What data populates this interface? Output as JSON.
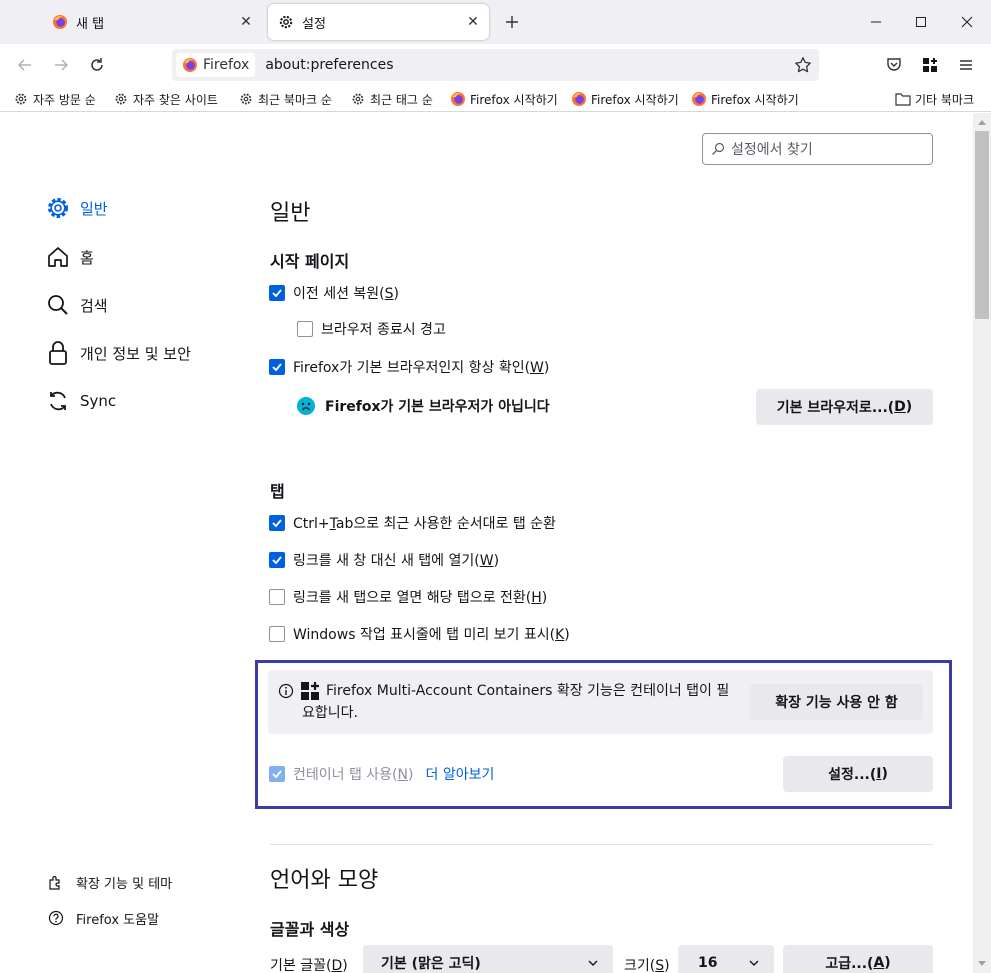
{
  "tabs": [
    {
      "label": "새 탭",
      "icon": "firefox-icon"
    },
    {
      "label": "설정",
      "icon": "gear-icon"
    }
  ],
  "nav": {
    "identity_label": "Firefox",
    "url": "about:preferences"
  },
  "bookmarks": [
    "자주 방문 순",
    "자주 찾은 사이트",
    "최근 북마크 순",
    "최근 태그 순",
    "Firefox 시작하기",
    "Firefox 시작하기",
    "Firefox 시작하기"
  ],
  "bookmarks_other": "기타 북마크",
  "search_placeholder": "설정에서 찾기",
  "categories": [
    "일반",
    "홈",
    "검색",
    "개인 정보 및 보안",
    "Sync"
  ],
  "footer": {
    "extensions": "확장 기능 및 테마",
    "help": "Firefox 도움말"
  },
  "general": {
    "title": "일반",
    "startup": {
      "title": "시작 페이지",
      "restore_session": {
        "text": "이전 세션 복원(",
        "key": "S",
        "end": ")",
        "checked": true
      },
      "warn_on_quit": {
        "text": "브라우저 종료시 경고",
        "checked": false
      },
      "check_default": {
        "text": "Firefox가 기본 브라우저인지 항상 확인(",
        "key": "W",
        "end": ")",
        "checked": true
      },
      "not_default": "Firefox가 기본 브라우저가 아닙니다",
      "make_default": {
        "text": "기본 브라우저로...(",
        "key": "D",
        "end": ")"
      }
    },
    "tabs": {
      "title": "탭",
      "ctrl_tab": {
        "pre": "Ctrl+",
        "key": "T",
        "post": "ab으로 최근 사용한 순서대로 탭 순환",
        "checked": true
      },
      "open_links": {
        "text": "링크를 새 창 대신 새 탭에 열기(",
        "key": "W",
        "end": ")",
        "checked": true
      },
      "switch_to_tab": {
        "text": "링크를 새 탭으로 열면 해당 탭으로 전환(",
        "key": "H",
        "end": ")",
        "checked": false
      },
      "taskbar_preview": {
        "text": "Windows 작업 표시줄에 탭 미리 보기 표시(",
        "key": "K",
        "end": ")",
        "checked": false
      },
      "containers_notice": "Firefox Multi-Account Containers 확장 기능은 컨테이너 탭이 필요합니다.",
      "disable_extension": "확장 기능 사용 안 함",
      "container_tabs": {
        "text": "컨테이너 탭 사용(",
        "key": "N",
        "end": ")",
        "checked": true,
        "disabled": true
      },
      "learn_more": "더 알아보기",
      "settings": {
        "text": "설정...(",
        "key": "I",
        "end": ")"
      }
    }
  },
  "language": {
    "title": "언어와 모양",
    "fonts": {
      "title": "글꼴과 색상",
      "default_font": {
        "text": "기본 글꼴(",
        "key": "D",
        "end": ")"
      },
      "font_value": "기본 (맑은 고딕)",
      "size": {
        "text": "크기(",
        "key": "S",
        "end": ")"
      },
      "size_value": "16",
      "advanced": {
        "text": "고급...(",
        "key": "A",
        "end": ")"
      }
    }
  },
  "colors": {
    "accent": "#0061e0",
    "highlight_frame": "#3c3ca8",
    "button_bg": "#e9e9ed",
    "info_bg": "#f0f0f4"
  }
}
